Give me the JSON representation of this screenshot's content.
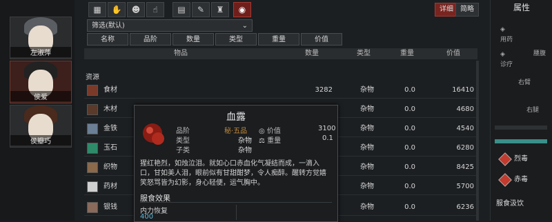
{
  "characters": [
    {
      "name": "左淑萍",
      "selected": false
    },
    {
      "name": "侯爱",
      "selected": true
    },
    {
      "name": "侯瓣巧",
      "selected": false
    }
  ],
  "toolbar": {
    "icons": [
      "grid-icon",
      "hand-icon",
      "people-icon",
      "hand-hold-icon",
      "scroll-icon",
      "brush-icon",
      "bag-icon",
      "eye-icon"
    ],
    "active_index": 7,
    "detail_label": "详细",
    "simple_label": "简略"
  },
  "filter": {
    "label": "筛选(默认)"
  },
  "sort_buttons": [
    "名称",
    "品阶",
    "数量",
    "类型",
    "重量",
    "价值"
  ],
  "table": {
    "headers": [
      "物品",
      "数量",
      "类型",
      "重量",
      "价值"
    ],
    "section_label": "资源",
    "rows": [
      {
        "name": "食材",
        "qty": "3282",
        "type": "杂物",
        "weight": "0.0",
        "value": "16410"
      },
      {
        "name": "木材",
        "qty": "",
        "type": "杂物",
        "weight": "0.0",
        "value": "4680"
      },
      {
        "name": "金铁",
        "qty": "",
        "type": "杂物",
        "weight": "0.0",
        "value": "4540"
      },
      {
        "name": "玉石",
        "qty": "",
        "type": "杂物",
        "weight": "0.0",
        "value": "6280"
      },
      {
        "name": "织物",
        "qty": "",
        "type": "杂物",
        "weight": "0.0",
        "value": "8425"
      },
      {
        "name": "药材",
        "qty": "",
        "type": "杂物",
        "weight": "0.0",
        "value": "5700"
      },
      {
        "name": "银钱",
        "qty": "",
        "type": "杂物",
        "weight": "0.0",
        "value": "6236"
      }
    ]
  },
  "tooltip": {
    "title": "血露",
    "grade_label": "品阶",
    "grade_value": "秘·五品",
    "type_label": "类型",
    "type_value": "杂物",
    "subtype_label": "子类",
    "subtype_value": "杂物",
    "value_label": "价值",
    "value_value": "3100",
    "weight_label": "重量",
    "weight_value": "0.1",
    "description": "猩红艳烈，如烛泣泪。就如心口赤血化气凝结而成，一滴入口，甘如美人泪，眼前似有甘甜酣梦，令人痴醉。醒转方觉嬉笑怒骂皆为幻影，身心轻便，运气胸中。",
    "effect_title": "服食效果",
    "stat_name": "内力恢复",
    "stat_value": "400"
  },
  "right_panel": {
    "title": "属性",
    "labels": [
      "用药",
      "诊疗",
      "腰腹",
      "右臂",
      "右腿"
    ],
    "poisons": [
      {
        "name": "烈毒",
        "color": "#c23b2e"
      },
      {
        "name": "赤毒",
        "color": "#c23b2e"
      }
    ],
    "footer": "服食汲饮"
  },
  "colors": {
    "accent": "#7a241f",
    "teal": "#3a8f8a",
    "stat": "#63b8d6"
  }
}
